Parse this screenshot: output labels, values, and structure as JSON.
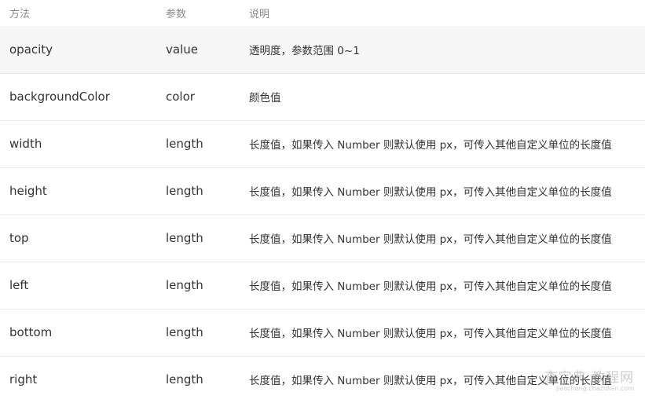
{
  "table": {
    "headers": [
      "方法",
      "参数",
      "说明"
    ],
    "rows": [
      {
        "method": "opacity",
        "param": "value",
        "desc": "透明度，参数范围 0~1"
      },
      {
        "method": "backgroundColor",
        "param": "color",
        "desc": "颜色值"
      },
      {
        "method": "width",
        "param": "length",
        "desc": "长度值，如果传入 Number 则默认使用 px，可传入其他自定义单位的长度值"
      },
      {
        "method": "height",
        "param": "length",
        "desc": "长度值，如果传入 Number 则默认使用 px，可传入其他自定义单位的长度值"
      },
      {
        "method": "top",
        "param": "length",
        "desc": "长度值，如果传入 Number 则默认使用 px，可传入其他自定义单位的长度值"
      },
      {
        "method": "left",
        "param": "length",
        "desc": "长度值，如果传入 Number 则默认使用 px，可传入其他自定义单位的长度值"
      },
      {
        "method": "bottom",
        "param": "length",
        "desc": "长度值，如果传入 Number 则默认使用 px，可传入其他自定义单位的长度值"
      },
      {
        "method": "right",
        "param": "length",
        "desc": "长度值，如果传入 Number 则默认使用 px，可传入其他自定义单位的长度值"
      }
    ]
  },
  "watermark": {
    "main": "查字典 教程网",
    "sub": "jiaocheng.chazidian.com"
  },
  "colors": {
    "header_text": "#8a8a8a",
    "body_text": "#333333",
    "row_border": "#e8e8e8",
    "first_row_bg": "#f7f7f7"
  }
}
